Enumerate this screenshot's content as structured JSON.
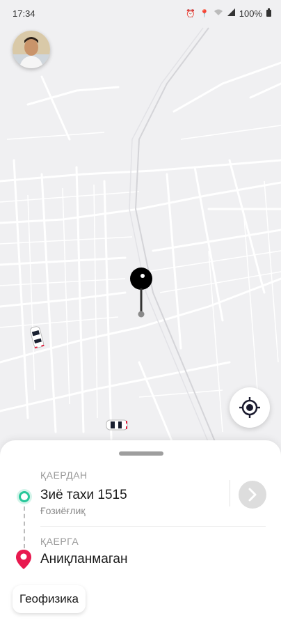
{
  "status_bar": {
    "time": "17:34",
    "battery": "100%",
    "icons": [
      "alarm-icon",
      "location-icon",
      "wifi-icon",
      "signal-icon",
      "battery-icon"
    ]
  },
  "map": {
    "background_color": "#f0f0f2",
    "road_color": "#ffffff"
  },
  "route": {
    "from_label": "ҚАЕРДАН",
    "from_value": "Зиё тахи 1515",
    "from_sub": "Ғозиёғлиқ",
    "to_label": "ҚАЕРГА",
    "to_value": "Аниқланмаган"
  },
  "chips": {
    "suggestion": "Геофизика"
  },
  "colors": {
    "from_accent": "#28c79a",
    "to_accent": "#e8194f"
  }
}
